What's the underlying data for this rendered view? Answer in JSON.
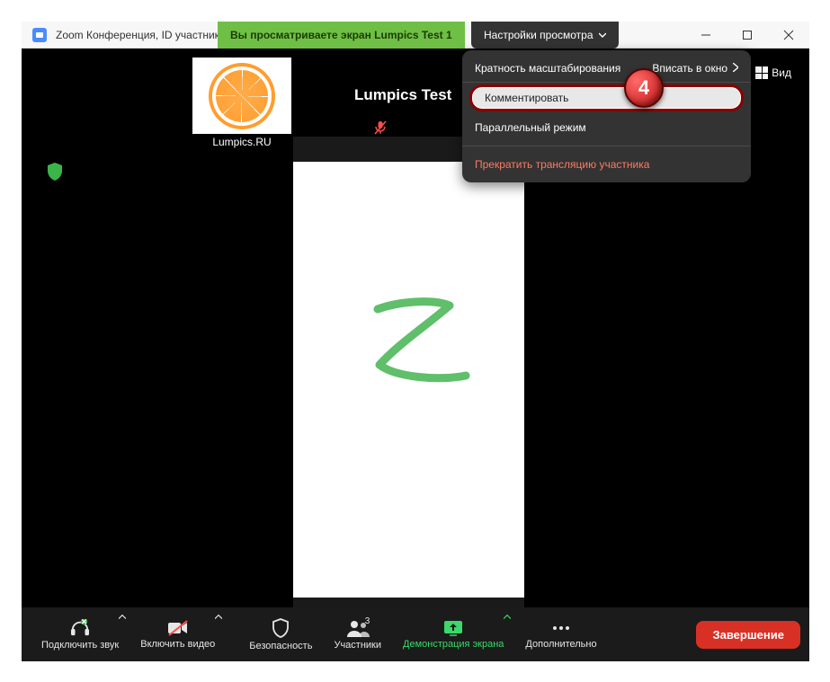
{
  "titlebar": {
    "title": "Zoom Конференция, ID участник"
  },
  "banner": {
    "text": "Вы просматриваете экран Lumpics Test 1"
  },
  "view_settings": {
    "label": "Настройки просмотра"
  },
  "dropdown": {
    "zoom_ratio": "Кратность масштабирования",
    "fit_window": "Вписать в окно",
    "annotate": "Комментировать",
    "side_by_side": "Параллельный режим",
    "stop_share": "Прекратить трансляцию участника"
  },
  "step_badge": "4",
  "top_right": {
    "view_label": "Вид"
  },
  "thumbnail": {
    "name": "Lumpics.RU"
  },
  "active_speaker": {
    "name": "Lumpics Test"
  },
  "toolbar": {
    "join_audio": "Подключить звук",
    "start_video": "Включить видео",
    "security": "Безопасность",
    "participants": "Участники",
    "participants_count": "3",
    "share_screen": "Демонстрация экрана",
    "more": "Дополнительно",
    "end": "Завершение"
  }
}
